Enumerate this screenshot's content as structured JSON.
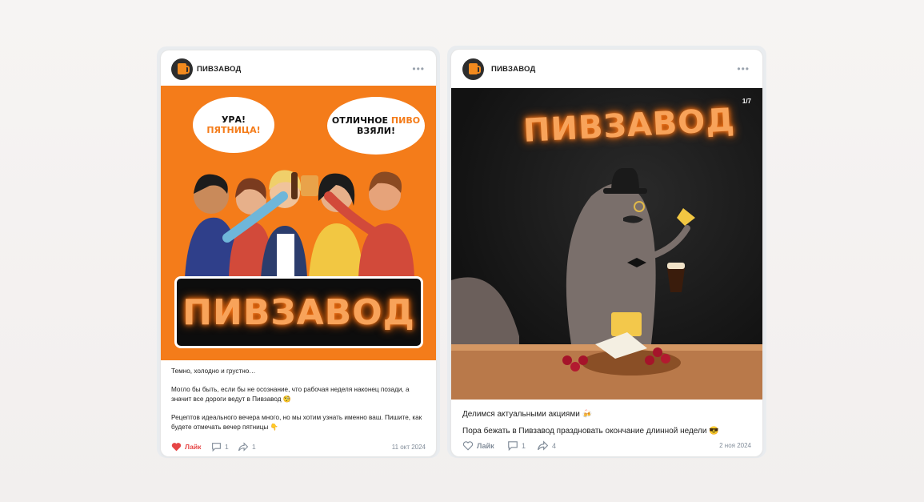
{
  "posts": [
    {
      "author": "ПИВЗАВОД",
      "more": "•••",
      "image": {
        "bubble1_line1": "УРА!",
        "bubble1_line2": "ПЯТНИЦА!",
        "bubble2_line1": "ОТЛИЧНОЕ",
        "bubble2_word": "ПИВО",
        "bubble2_line2": "ВЗЯЛИ!",
        "brand": "ПИВЗАВОД"
      },
      "text": [
        "Темно, холодно и грустно…",
        "Могло бы быть, если бы не осознание, что рабочая неделя наконец позади, а значит все дороги ведут в Пивзавод 🧐",
        "Рецептов идеального вечера много, но мы хотим узнать именно ваш. Пишите, как будете отмечать вечер пятницы 👇"
      ],
      "like_label": "Лайк",
      "comments": "1",
      "shares": "1",
      "date": "11 окт 2024"
    },
    {
      "author": "ПИВЗАВОД",
      "more": "•••",
      "image": {
        "counter": "1/7",
        "brand": "ПИВЗАВОД"
      },
      "text": [
        "Делимся актуальными акциями 🍻",
        "Пора бежать в Пивзавод праздновать окончание длинной недели 😎"
      ],
      "like_label": "Лайк",
      "comments": "1",
      "shares": "4",
      "date": "2 ноя 2024"
    }
  ],
  "colors": {
    "accent": "#f47c1a",
    "like_active": "#e64646",
    "muted": "#818c99"
  }
}
